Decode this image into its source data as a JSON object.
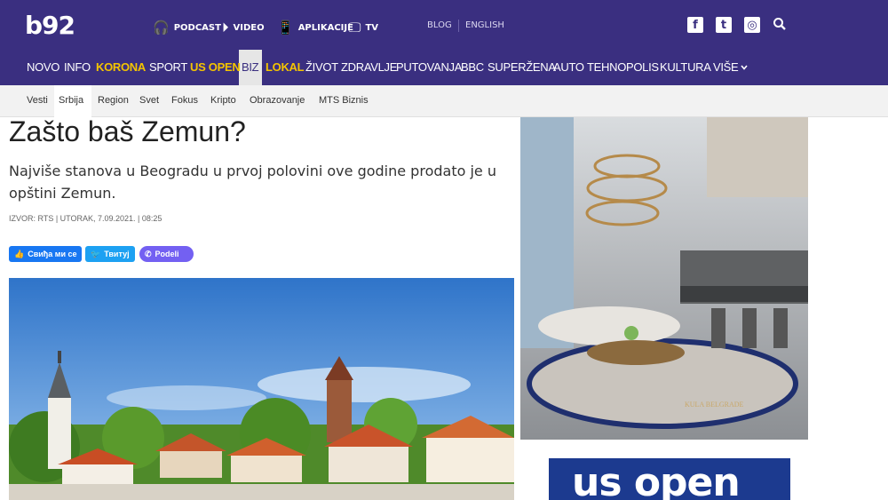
{
  "header": {
    "logo": "b92",
    "util_links": [
      {
        "label": "PODCAST",
        "icon": "headphones-icon"
      },
      {
        "label": "VIDEO",
        "icon": "play-icon"
      },
      {
        "label": "APLIKACIJE",
        "icon": "phone-icon"
      },
      {
        "label": "TV",
        "icon": "tv-icon"
      }
    ],
    "blog": "BLOG",
    "english": "ENGLISH",
    "social": [
      "facebook-icon",
      "twitter-icon",
      "instagram-icon"
    ]
  },
  "main_nav": [
    {
      "label": "NOVO",
      "style": "normal"
    },
    {
      "label": "INFO",
      "style": "normal"
    },
    {
      "label": "KORONA",
      "style": "yellow"
    },
    {
      "label": "SPORT",
      "style": "normal"
    },
    {
      "label": "US OPEN",
      "style": "yellow"
    },
    {
      "label": "BIZ",
      "style": "active"
    },
    {
      "label": "LOKAL",
      "style": "yellow"
    },
    {
      "label": "ŽIVOT",
      "style": "normal"
    },
    {
      "label": "ZDRAVLJE",
      "style": "normal"
    },
    {
      "label": "PUTOVANJA",
      "style": "normal"
    },
    {
      "label": "BBC",
      "style": "normal"
    },
    {
      "label": "SUPERŽENA",
      "style": "normal"
    },
    {
      "label": "AUTO",
      "style": "normal"
    },
    {
      "label": "TEHNOPOLIS",
      "style": "normal"
    },
    {
      "label": "KULTURA",
      "style": "normal"
    },
    {
      "label": "VIŠE",
      "style": "normal"
    }
  ],
  "sub_nav": [
    "Vesti",
    "Srbija",
    "Region",
    "Svet",
    "Fokus",
    "Kripto",
    "Obrazovanje",
    "MTS Biznis"
  ],
  "article": {
    "title": "Zašto baš Zemun?",
    "lead": "Najviše stanova u Beogradu u prvoj polovini ove godine prodato je u opštini Zemun.",
    "meta": "IZVOR: RTS | UTORAK, 7.09.2021. | 08:25"
  },
  "share": {
    "facebook": "Свиђа ми се",
    "twitter": "Твитуј",
    "viber": "Podeli"
  },
  "ads": {
    "ad1_brand": "KULA BELGRADE",
    "ad2_text": "us open"
  },
  "colors": {
    "brand": "#3a2f80",
    "accent_yellow": "#f4c400",
    "facebook": "#1877f2",
    "twitter": "#1da1f2",
    "viber": "#7360f2"
  }
}
